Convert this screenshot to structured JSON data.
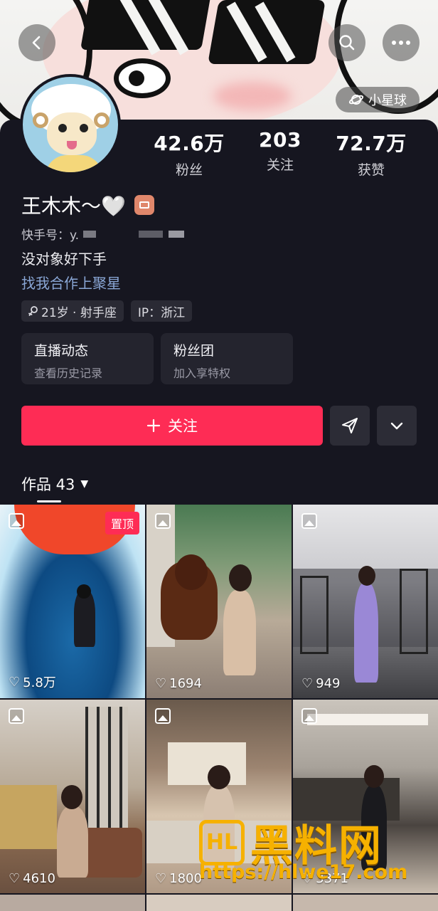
{
  "header": {
    "back_icon": "chevron-left-icon",
    "search_icon": "search-icon",
    "more_icon": "more-icon",
    "planet_label": "小星球"
  },
  "profile": {
    "name": "王木木～🤍",
    "kid_label": "快手号：y.",
    "bio": "没对象好下手",
    "link": "找我合作上聚星",
    "tags": [
      {
        "label": "21岁 · 射手座"
      },
      {
        "label": "IP：浙江"
      }
    ]
  },
  "stats": [
    {
      "value": "42.6万",
      "label": "粉丝"
    },
    {
      "value": "203",
      "label": "关注"
    },
    {
      "value": "72.7万",
      "label": "获赞"
    }
  ],
  "features": [
    {
      "title": "直播动态",
      "subtitle": "查看历史记录"
    },
    {
      "title": "粉丝团",
      "subtitle": "加入享特权"
    }
  ],
  "actions": {
    "follow_label": "关注",
    "follow_icon": "plus-icon",
    "share_icon": "send-icon",
    "expand_icon": "chevron-down-icon"
  },
  "works": {
    "tab_label": "作品 43"
  },
  "posts": [
    {
      "likes": "5.8万",
      "pinned": "置顶"
    },
    {
      "likes": "1694"
    },
    {
      "likes": "949"
    },
    {
      "likes": "4610"
    },
    {
      "likes": "1800"
    },
    {
      "likes": "3371"
    }
  ],
  "watermark": {
    "logo": "HL",
    "text": "黑料网",
    "url": "https://hlwe17.com"
  },
  "colors": {
    "accent": "#fe2c55",
    "background": "#161620",
    "link": "#8aa7d6",
    "watermark": "#f6b100"
  }
}
